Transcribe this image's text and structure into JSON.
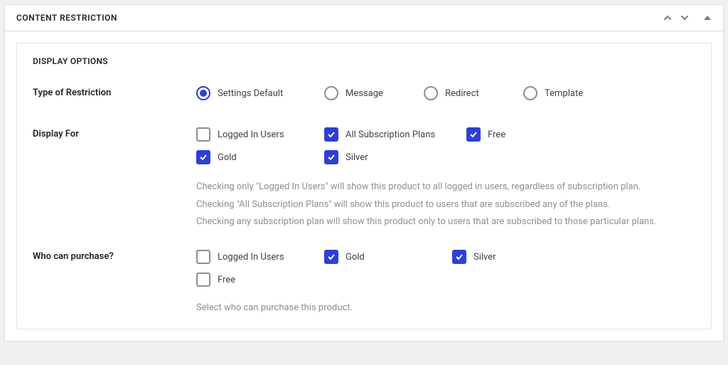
{
  "panel": {
    "title": "CONTENT RESTRICTION"
  },
  "section": {
    "heading": "DISPLAY OPTIONS"
  },
  "restriction": {
    "label": "Type of Restriction",
    "options": {
      "default": "Settings Default",
      "message": "Message",
      "redirect": "Redirect",
      "template": "Template"
    }
  },
  "displayFor": {
    "label": "Display For",
    "options": {
      "loggedIn": "Logged In Users",
      "allPlans": "All Subscription Plans",
      "free": "Free",
      "gold": "Gold",
      "silver": "Silver"
    },
    "help": {
      "l1": "Checking only \"Logged In Users\" will show this product to all logged in users, regardless of subscription plan.",
      "l2": "Checking \"All Subscription Plans\" will show this product to users that are subscribed any of the plans.",
      "l3": "Checking any subscription plan will show this product only to users that are subscribed to those particular plans."
    }
  },
  "purchase": {
    "label": "Who can purchase?",
    "options": {
      "loggedIn": "Logged In Users",
      "gold": "Gold",
      "silver": "Silver",
      "free": "Free"
    },
    "help": "Select who can purchase this product."
  }
}
